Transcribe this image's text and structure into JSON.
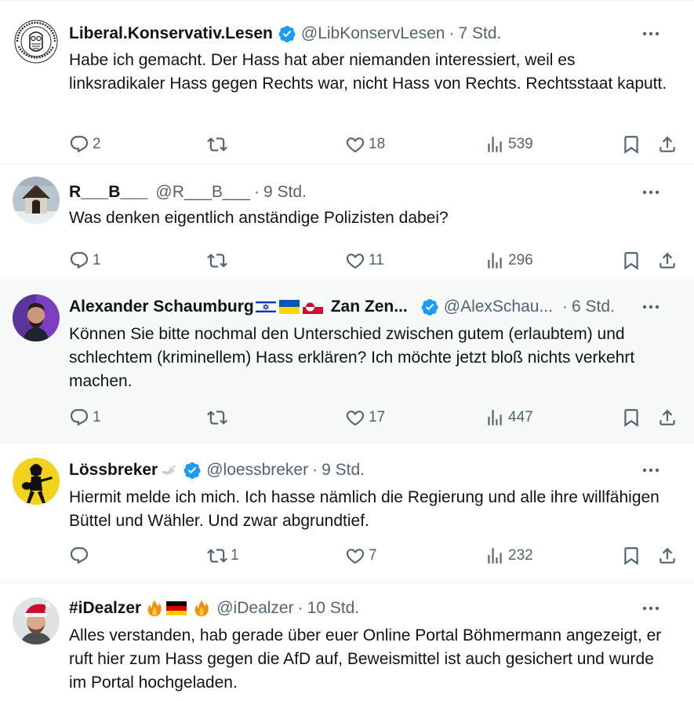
{
  "tweets": [
    {
      "name": "Liberal.Konservativ.Lesen",
      "handle": "@LibKonservLesen",
      "sep": "·",
      "time": "7 Std.",
      "text": "Habe ich gemacht. Der Hass hat aber niemanden interessiert, weil es linksradikaler Hass gegen Rechts war, nicht Hass von Rechts. Rechtsstaat kaputt.",
      "replies": "2",
      "reposts": "",
      "likes": "18",
      "views": "539"
    },
    {
      "name": "R___B___",
      "handle": "@R___B___",
      "sep": "·",
      "time": "9 Std.",
      "text": "Was denken eigentlich anständige Polizisten dabei?",
      "replies": "1",
      "reposts": "",
      "likes": "11",
      "views": "296"
    },
    {
      "name": "Alexander Schaumburg",
      "name2": "Zan Zen...",
      "handle": "@AlexSchau...",
      "sep": "·",
      "time": "6 Std.",
      "text": "Können Sie bitte nochmal den Unterschied zwischen gutem (erlaubtem) und schlechtem (kriminellem) Hass erklären? Ich möchte jetzt bloß nichts verkehrt machen.",
      "replies": "1",
      "reposts": "",
      "likes": "17",
      "views": "447"
    },
    {
      "name": "Lössbreker",
      "handle": "@loessbreker",
      "sep": "·",
      "time": "9 Std.",
      "text": "Hiermit melde ich mich. Ich hasse nämlich die Regierung und alle ihre willfähigen Büttel und Wähler. Und zwar abgrundtief.",
      "replies": "",
      "reposts": "1",
      "likes": "7",
      "views": "232"
    },
    {
      "name": "#iDealzer",
      "handle": "@iDealzer",
      "sep": "·",
      "time": "10 Std.",
      "text": "Alles verstanden, hab gerade über euer Online Portal Böhmermann angezeigt, er ruft hier zum Hass gegen die AfD auf, Beweismittel ist auch gesichert und wurde im Portal hochgeladen."
    }
  ],
  "icons": {
    "reply": "reply-icon",
    "repost": "repost-icon",
    "like": "heart-icon",
    "views": "views-icon",
    "bookmark": "bookmark-icon",
    "share": "share-icon",
    "more": "more-icon",
    "verified": "verified-badge-icon"
  },
  "colors": {
    "verified": "#1d9bf0",
    "secondary": "#536471",
    "text": "#0f1419",
    "divider": "#eff3f4",
    "highlight": "#f7f9f9"
  }
}
